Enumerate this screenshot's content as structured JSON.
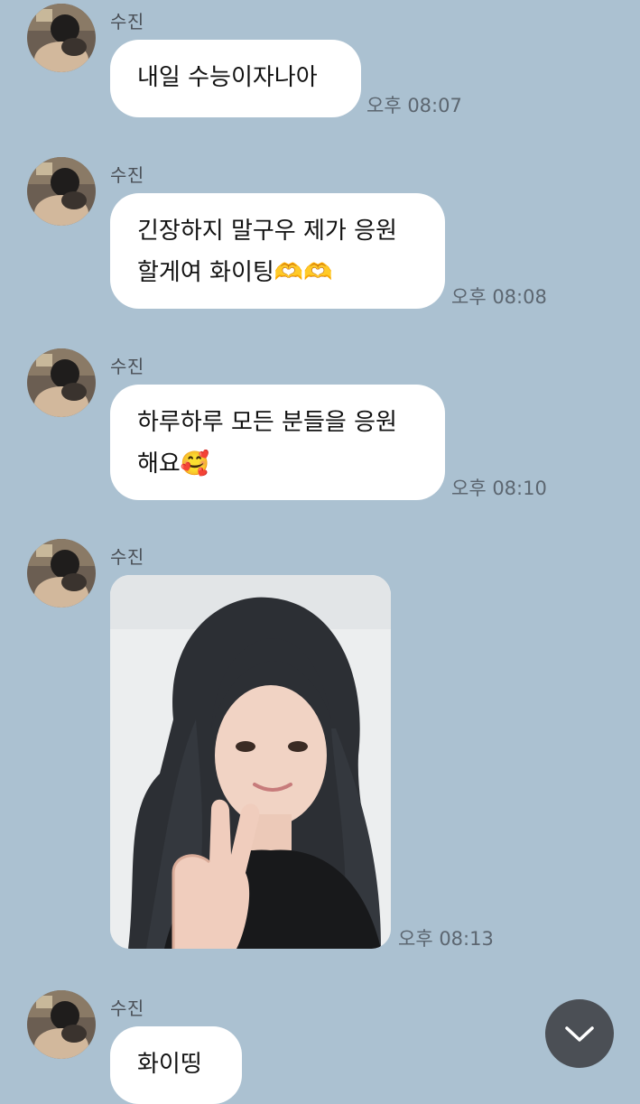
{
  "colors": {
    "chat_background": "#abc1d1",
    "bubble": "#ffffff",
    "scroll_button": "#4b4f55"
  },
  "messages": [
    {
      "sender": "수진",
      "text": "내일 수능이자나아",
      "time": "오후 08:07"
    },
    {
      "sender": "수진",
      "text": "긴장하지 말구우 제가 응원\n할게여 화이팅🫶🫶",
      "time": "오후 08:08"
    },
    {
      "sender": "수진",
      "text": "하루하루 모든 분들을 응원\n해요🥰",
      "time": "오후 08:10"
    },
    {
      "sender": "수진",
      "type": "photo",
      "photo_icon": "selfie-photo-peace-sign",
      "time": "오후 08:13"
    },
    {
      "sender": "수진",
      "text": "화이띵"
    }
  ],
  "scroll_button": {
    "icon": "chevron-down-icon"
  }
}
